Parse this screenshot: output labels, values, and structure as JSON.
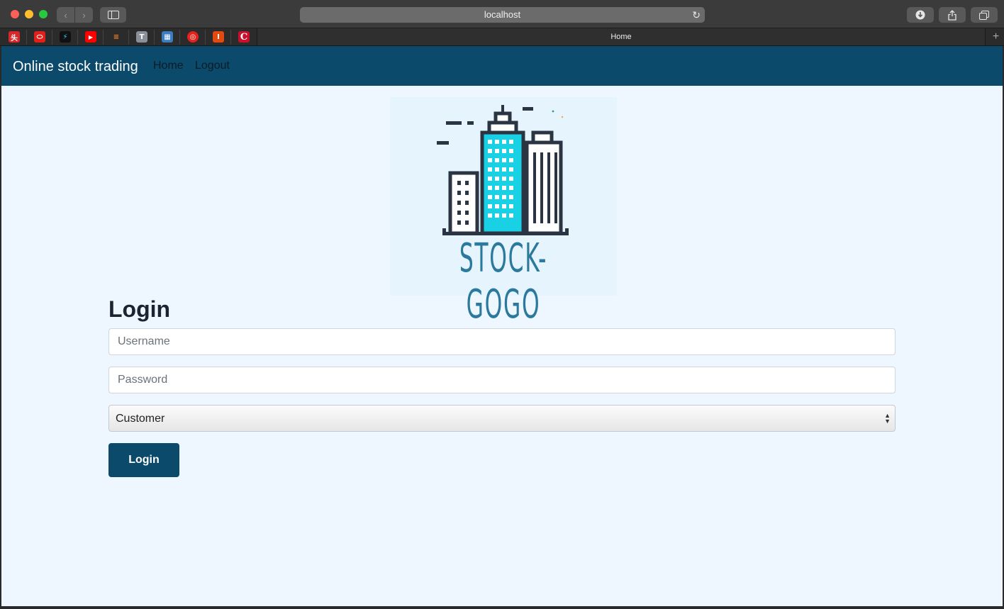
{
  "browser": {
    "address": "localhost",
    "tab_title": "Home",
    "favorites": [
      {
        "name": "toutiao-favicon",
        "glyph": "头",
        "bg": "#d6272b"
      },
      {
        "name": "oracle-favicon",
        "glyph": "⬭",
        "bg": "#e0201b"
      },
      {
        "name": "bolt-favicon",
        "glyph": "⚡",
        "bg": "#111111"
      },
      {
        "name": "youtube-favicon",
        "glyph": "▶",
        "bg": "#ff0000"
      },
      {
        "name": "stackoverflow-favicon",
        "glyph": "≡",
        "bg": "#2b2b2b"
      },
      {
        "name": "t-favicon",
        "glyph": "T",
        "bg": "#8a8f98"
      },
      {
        "name": "photo-favicon",
        "glyph": "▦",
        "bg": "#3a7dbf"
      },
      {
        "name": "netease-music-favicon",
        "glyph": "◎",
        "bg": "#e2221b"
      },
      {
        "name": "i-favicon",
        "glyph": "I",
        "bg": "#e24a10"
      },
      {
        "name": "c-favicon",
        "glyph": "C",
        "bg": "#c8102e"
      }
    ]
  },
  "nav": {
    "brand": "Online stock trading",
    "links": [
      "Home",
      "Logout"
    ]
  },
  "logo": {
    "text": "STOCK-GOGO",
    "colors": {
      "outline": "#2a3442",
      "window_fill": "#19d1e4",
      "text": "#2b7a9e"
    }
  },
  "login": {
    "title": "Login",
    "username_placeholder": "Username",
    "password_placeholder": "Password",
    "role_selected": "Customer",
    "submit_label": "Login"
  },
  "colors": {
    "navbar": "#0b4a6a",
    "page_bg": "#eef7ff",
    "button": "#0b4a6a"
  }
}
